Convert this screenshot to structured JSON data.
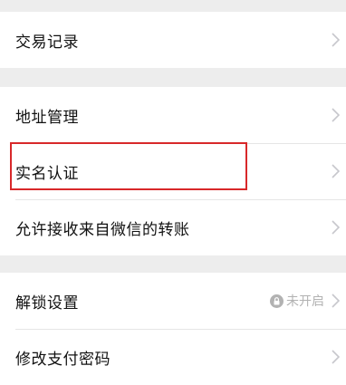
{
  "menu": {
    "transactions_label": "交易记录",
    "address_label": "地址管理",
    "realname_label": "实名认证",
    "wechat_transfer_label": "允许接收来自微信的转账",
    "unlock_label": "解锁设置",
    "unlock_status": "未开启",
    "change_password_label": "修改支付密码"
  },
  "icons": {
    "row_chevron": "chevron-right-icon",
    "unlock_status_icon": "lock-icon"
  },
  "colors": {
    "page_background": "#ededed",
    "row_background": "#ffffff",
    "highlight_border": "#d8282a",
    "status_text": "#b2b2b2"
  }
}
